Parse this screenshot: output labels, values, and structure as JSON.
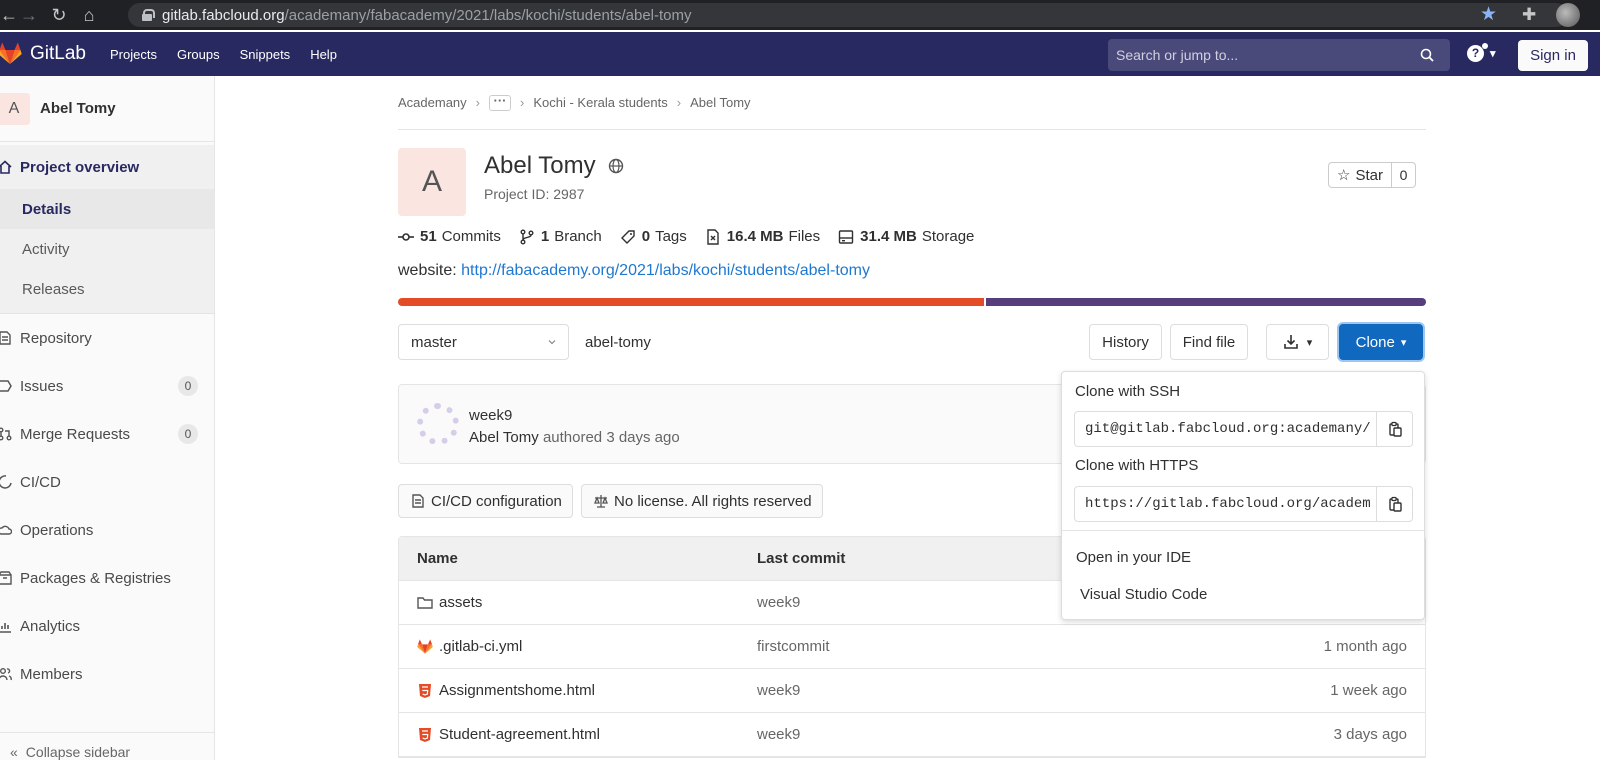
{
  "browser": {
    "url_host": "gitlab.fabcloud.org",
    "url_path": "/academany/fabacademy/2021/labs/kochi/students/abel-tomy"
  },
  "header": {
    "brand": "GitLab",
    "nav": [
      "Projects",
      "Groups",
      "Snippets",
      "Help"
    ],
    "search_placeholder": "Search or jump to...",
    "sign_in": "Sign in"
  },
  "sidebar": {
    "project_initial": "A",
    "project_name": "Abel Tomy",
    "overview": "Project overview",
    "overview_items": [
      "Details",
      "Activity",
      "Releases"
    ],
    "items": [
      {
        "label": "Repository"
      },
      {
        "label": "Issues",
        "count": "0"
      },
      {
        "label": "Merge Requests",
        "count": "0"
      },
      {
        "label": "CI/CD"
      },
      {
        "label": "Operations"
      },
      {
        "label": "Packages & Registries"
      },
      {
        "label": "Analytics"
      },
      {
        "label": "Members"
      }
    ],
    "collapse": "Collapse sidebar"
  },
  "breadcrumb": {
    "root": "Academany",
    "more": "···",
    "parent": "Kochi - Kerala students",
    "current": "Abel Tomy"
  },
  "project": {
    "initial": "A",
    "name": "Abel Tomy",
    "id_label": "Project ID: 2987",
    "star_label": "Star",
    "star_count": "0",
    "stats": {
      "commits_num": "51",
      "commits_label": "Commits",
      "branch_num": "1",
      "branch_label": "Branch",
      "tags_num": "0",
      "tags_label": "Tags",
      "files_num": "16.4 MB",
      "files_label": "Files",
      "storage_num": "31.4 MB",
      "storage_label": "Storage"
    },
    "website_label": "website:",
    "website_url": "http://fabacademy.org/2021/labs/kochi/students/abel-tomy"
  },
  "languages": [
    {
      "color": "#e34c26",
      "fraction": 0.57
    },
    {
      "color": "#563d7c",
      "fraction": 0.43
    }
  ],
  "toolbar": {
    "branch": "master",
    "path": "abel-tomy",
    "history": "History",
    "find_file": "Find file",
    "clone": "Clone"
  },
  "last_commit": {
    "title": "week9",
    "author": "Abel Tomy",
    "meta": "authored 3 days ago"
  },
  "pills": {
    "cicd": "CI/CD configuration",
    "license": "No license. All rights reserved"
  },
  "files": {
    "col_name": "Name",
    "col_commit": "Last commit",
    "rows": [
      {
        "name": "assets",
        "commit": "week9",
        "time": "",
        "type": "folder"
      },
      {
        "name": ".gitlab-ci.yml",
        "commit": "firstcommit",
        "time": "1 month ago",
        "type": "gitlab"
      },
      {
        "name": "Assignmentshome.html",
        "commit": "week9",
        "time": "1 week ago",
        "type": "html"
      },
      {
        "name": "Student-agreement.html",
        "commit": "week9",
        "time": "3 days ago",
        "type": "html"
      }
    ]
  },
  "clone_dropdown": {
    "ssh_label": "Clone with SSH",
    "ssh_value": "git@gitlab.fabcloud.org:academany/",
    "https_label": "Clone with HTTPS",
    "https_value": "https://gitlab.fabcloud.org/academ",
    "ide_label": "Open in your IDE",
    "ide_option": "Visual Studio Code"
  }
}
